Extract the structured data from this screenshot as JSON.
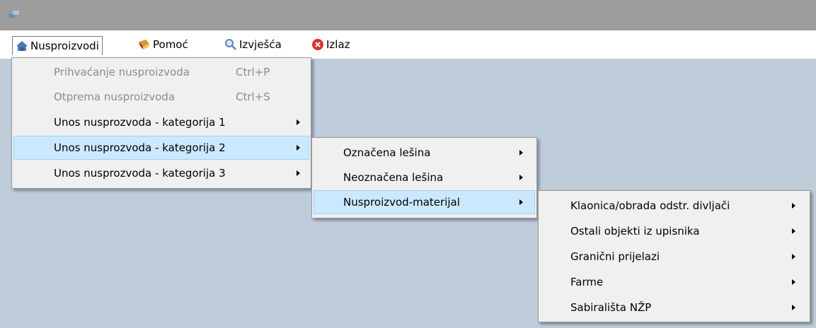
{
  "menubar": {
    "items": [
      {
        "label": "Nusproizvodi",
        "icon": "house-icon"
      },
      {
        "label": "Pomoć",
        "icon": "help-book-icon"
      },
      {
        "label": "Izvješća",
        "icon": "magnifier-icon"
      },
      {
        "label": "Izlaz",
        "icon": "exit-icon"
      }
    ]
  },
  "menu1": {
    "items": [
      {
        "label": "Prihvaćanje nusproizvoda",
        "shortcut": "Ctrl+P",
        "enabled": false
      },
      {
        "label": "Otprema nusproizvoda",
        "shortcut": "Ctrl+S",
        "enabled": false
      },
      {
        "label": "Unos nusprozvoda - kategorija 1",
        "submenu": true
      },
      {
        "label": "Unos nusprozvoda - kategorija 2",
        "submenu": true,
        "highlighted": true
      },
      {
        "label": "Unos nusprozvoda - kategorija 3",
        "submenu": true
      }
    ]
  },
  "menu2": {
    "items": [
      {
        "label": "Označena lešina",
        "submenu": true
      },
      {
        "label": "Neoznačena lešina",
        "submenu": true
      },
      {
        "label": "Nusproizvod-materijal",
        "submenu": true,
        "highlighted": true
      }
    ]
  },
  "menu3": {
    "items": [
      {
        "label": "Klaonica/obrada odstr. divljači",
        "submenu": true
      },
      {
        "label": "Ostali objekti iz upisnika",
        "submenu": true
      },
      {
        "label": "Granični prijelazi",
        "submenu": true
      },
      {
        "label": "Farme",
        "submenu": true
      },
      {
        "label": "Sabirališta NŽP",
        "submenu": true
      }
    ]
  },
  "colors": {
    "background": "#bfcddb",
    "titlebar": "#9d9d9d",
    "highlight": "#cce8ff",
    "highlight_border": "#99d1ff",
    "disabled_text": "#8c8c8c"
  }
}
